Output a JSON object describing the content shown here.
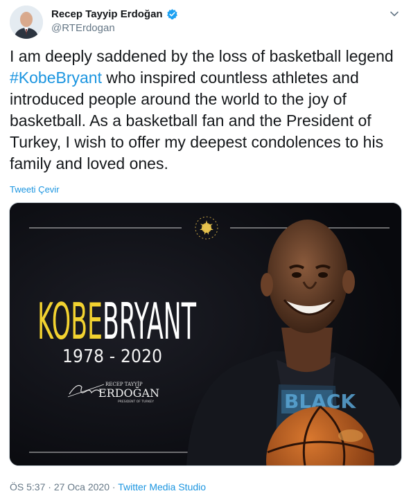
{
  "author": {
    "name": "Recep Tayyip Erdoğan",
    "handle": "@RTErdogan"
  },
  "tweet": {
    "text_before": "I am deeply saddened by the loss of basketball legend ",
    "hashtag": "#KobeBryant",
    "text_after": " who inspired countless athletes and introduced people around the world to the joy of basketball. As a basketball fan and the President of Turkey, I wish to offer my deepest condolences to his family and loved ones.",
    "translate_label": "Tweeti Çevir"
  },
  "media": {
    "name_first": "KOBE",
    "name_last": "BRYANT",
    "years": "1978 - 2020",
    "signature_top": "RECEP TAYYİP",
    "signature_name": "ERDOĞAN",
    "signature_title": "PRESIDENT OF TURKEY",
    "jersey_text": "BLACK"
  },
  "meta": {
    "time": "ÖS 5:37",
    "date": "27 Oca 2020",
    "source": "Twitter Media Studio",
    "sep": "·"
  },
  "colors": {
    "link": "#1b95e0",
    "verified": "#1da1f2",
    "kobe_yellow": "#f2d230",
    "background_dark": "#0c0d12"
  }
}
